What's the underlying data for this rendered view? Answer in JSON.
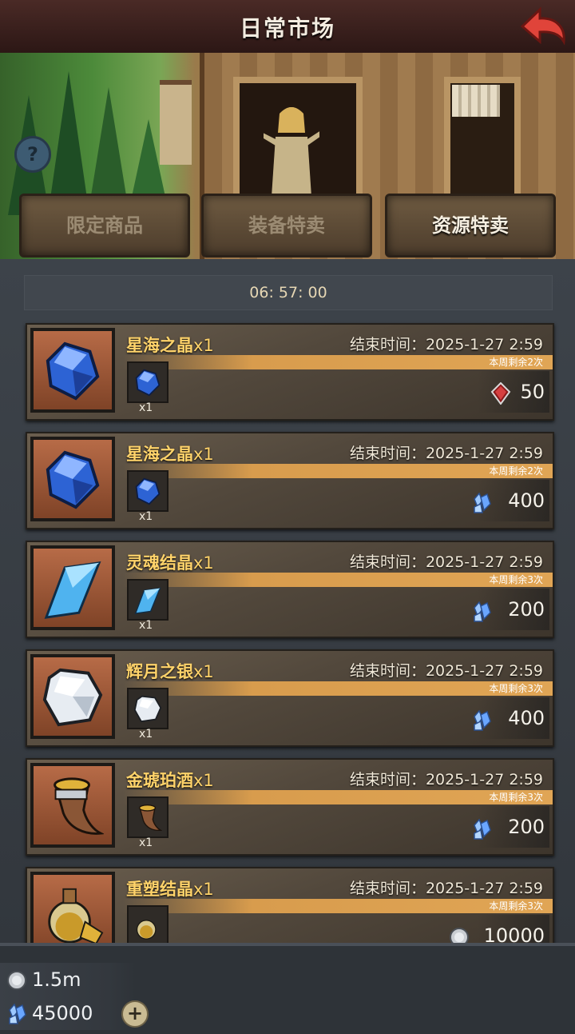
{
  "header": {
    "title": "日常市场",
    "back_icon": "back-arrow-icon"
  },
  "banner": {
    "help_icon": "question-mark-icon",
    "help_text": "?"
  },
  "tabs": [
    {
      "label": "限定商品",
      "active": false
    },
    {
      "label": "装备特卖",
      "active": false
    },
    {
      "label": "资源特卖",
      "active": true
    }
  ],
  "timer": "06: 57: 00",
  "items": [
    {
      "name": "星海之晶",
      "count": "x1",
      "end_label": "结束时间：2025-1-27 2:59",
      "remaining": "本周剩余2次",
      "qty": "x1",
      "price": "50",
      "currency_icon": "red-gem-icon",
      "item_icon": "blue-crystal-icon"
    },
    {
      "name": "星海之晶",
      "count": "x1",
      "end_label": "结束时间：2025-1-27 2:59",
      "remaining": "本周剩余2次",
      "qty": "x1",
      "price": "400",
      "currency_icon": "blue-crystal-currency-icon",
      "item_icon": "blue-crystal-icon"
    },
    {
      "name": "灵魂结晶",
      "count": "x1",
      "end_label": "结束时间：2025-1-27 2:59",
      "remaining": "本周剩余3次",
      "qty": "x1",
      "price": "200",
      "currency_icon": "blue-crystal-currency-icon",
      "item_icon": "light-blue-shard-icon"
    },
    {
      "name": "辉月之银",
      "count": "x1",
      "end_label": "结束时间：2025-1-27 2:59",
      "remaining": "本周剩余3次",
      "qty": "x1",
      "price": "400",
      "currency_icon": "blue-crystal-currency-icon",
      "item_icon": "silver-ore-icon"
    },
    {
      "name": "金琥珀酒",
      "count": "x1",
      "end_label": "结束时间：2025-1-27 2:59",
      "remaining": "本周剩余3次",
      "qty": "x1",
      "price": "200",
      "currency_icon": "blue-crystal-currency-icon",
      "item_icon": "drinking-horn-icon"
    },
    {
      "name": "重塑结晶",
      "count": "x1",
      "end_label": "结束时间：2025-1-27 2:59",
      "remaining": "本周剩余3次",
      "qty": "",
      "price": "10000",
      "currency_icon": "silver-coin-icon",
      "item_icon": "gold-flask-icon"
    }
  ],
  "resources": [
    {
      "value": "1.5m",
      "icon": "silver-coin-icon"
    },
    {
      "value": "45000",
      "icon": "blue-crystal-currency-icon"
    }
  ],
  "colors": {
    "item_name": "#ffd36a",
    "remaining_strip": "#e0a555",
    "header_bg": "#4a2a26",
    "back_arrow": "#e0443a"
  }
}
